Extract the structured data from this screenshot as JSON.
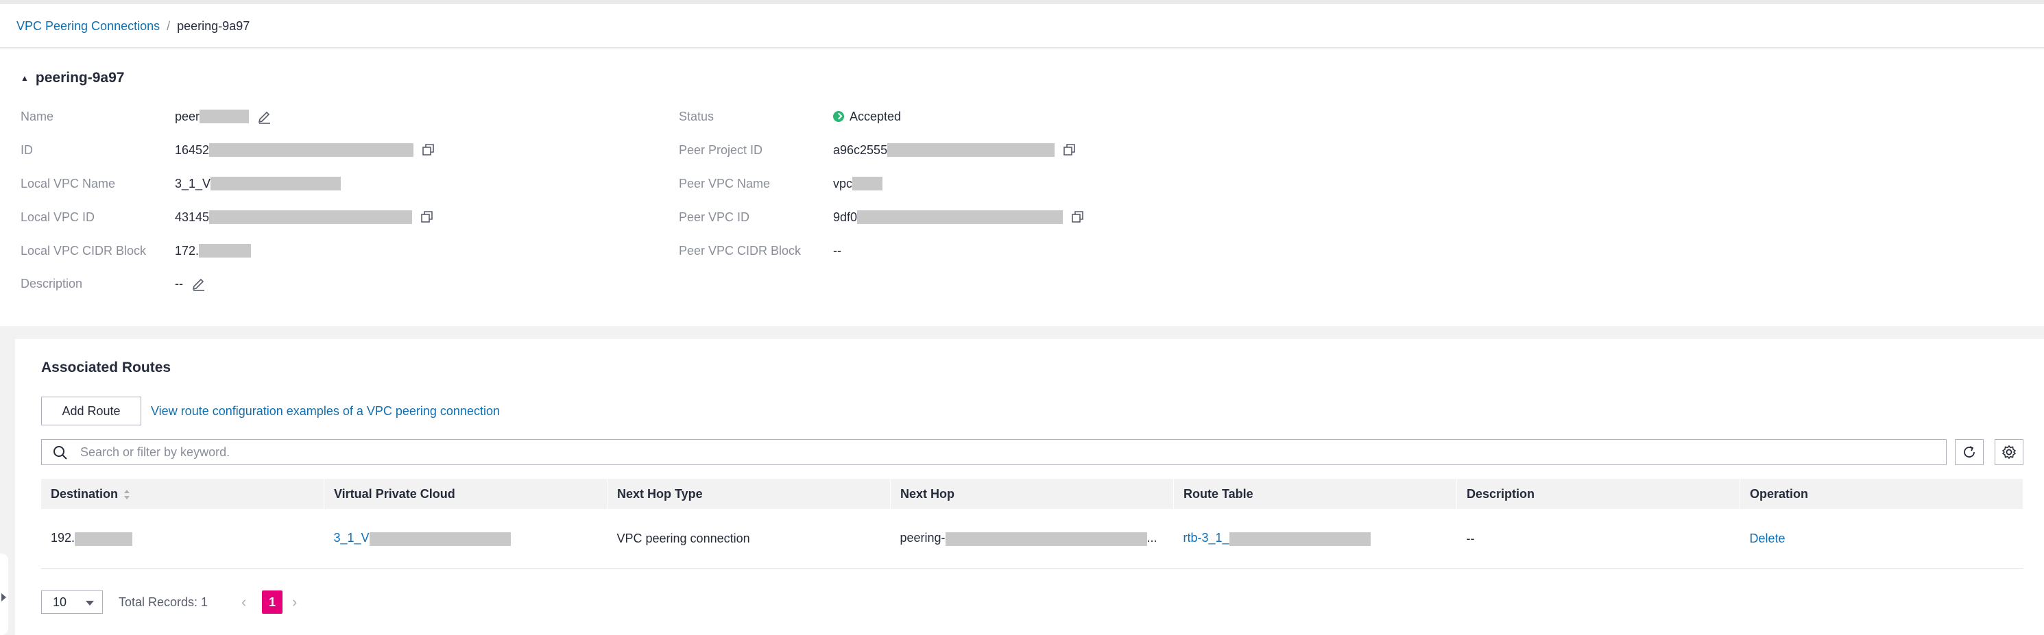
{
  "breadcrumb": {
    "parent": "VPC Peering Connections",
    "separator": "/",
    "current": "peering-9a97"
  },
  "detail": {
    "title": "peering-9a97",
    "left": [
      {
        "label": "Name",
        "value": "peer"
      },
      {
        "label": "ID",
        "value": "16452"
      },
      {
        "label": "Local VPC Name",
        "value": "3_1_V"
      },
      {
        "label": "Local VPC ID",
        "value": "43145"
      },
      {
        "label": "Local VPC CIDR Block",
        "value": "172."
      },
      {
        "label": "Description",
        "value": "--"
      }
    ],
    "right": [
      {
        "label": "Status",
        "value": "Accepted"
      },
      {
        "label": "Peer Project ID",
        "value": "a96c2555"
      },
      {
        "label": "Peer VPC Name",
        "value": "vpc"
      },
      {
        "label": "Peer VPC ID",
        "value": "9df0"
      },
      {
        "label": "Peer VPC CIDR Block",
        "value": "--"
      }
    ],
    "status_color": "#2bb673"
  },
  "routes": {
    "title": "Associated Routes",
    "add_button": "Add Route",
    "examples_link": "View route configuration examples of a VPC peering connection",
    "search_placeholder": "Search or filter by keyword.",
    "columns": [
      "Destination",
      "Virtual Private Cloud",
      "Next Hop Type",
      "Next Hop",
      "Route Table",
      "Description",
      "Operation"
    ],
    "rows": [
      {
        "destination": "192.",
        "vpc": "3_1_V",
        "next_hop_type": "VPC peering connection",
        "next_hop": "peering-",
        "next_hop_suffix": "...",
        "route_table": "rtb-3_1_",
        "description": "--",
        "operation": "Delete"
      }
    ]
  },
  "pagination": {
    "page_size": "10",
    "total": "Total Records: 1",
    "current_page": "1"
  },
  "colors": {
    "link": "#0f6fb0",
    "accent_page": "#e6007a"
  }
}
